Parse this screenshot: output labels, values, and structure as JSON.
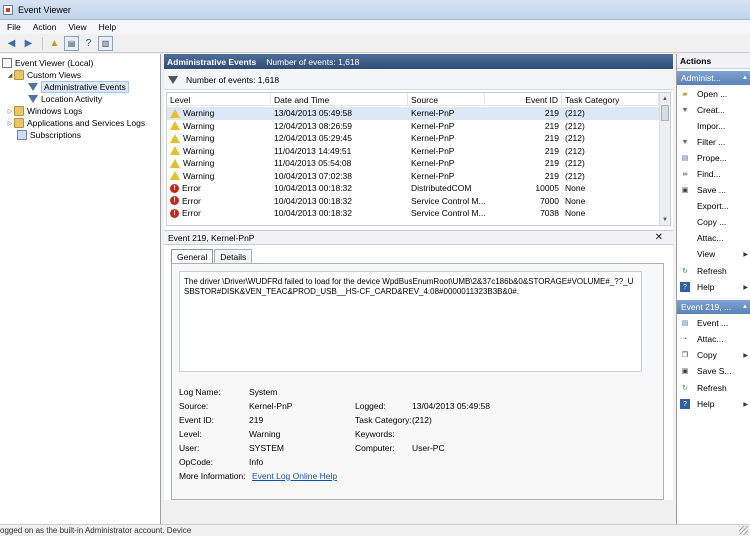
{
  "window": {
    "title": "Event Viewer"
  },
  "menu": [
    "File",
    "Action",
    "View",
    "Help"
  ],
  "tree": {
    "root": "Event Viewer (Local)",
    "custom_views": "Custom Views",
    "administrative_events": "Administrative Events",
    "location_activity": "Location Activity",
    "windows_logs": "Windows Logs",
    "apps_services_logs": "Applications and Services Logs",
    "subscriptions": "Subscriptions"
  },
  "center": {
    "header_title": "Administrative Events",
    "header_count": "Number of events: 1,618",
    "filter_count": "Number of events: 1,618"
  },
  "grid": {
    "columns": [
      "Level",
      "Date and Time",
      "Source",
      "Event ID",
      "Task Category"
    ],
    "rows": [
      {
        "level": "Warning",
        "date": "13/04/2013 05:49:58",
        "source": "Kernel-PnP",
        "id": "219",
        "task": "(212)"
      },
      {
        "level": "Warning",
        "date": "12/04/2013 08:26:59",
        "source": "Kernel-PnP",
        "id": "219",
        "task": "(212)"
      },
      {
        "level": "Warning",
        "date": "12/04/2013 05:29:45",
        "source": "Kernel-PnP",
        "id": "219",
        "task": "(212)"
      },
      {
        "level": "Warning",
        "date": "11/04/2013 14:49:51",
        "source": "Kernel-PnP",
        "id": "219",
        "task": "(212)"
      },
      {
        "level": "Warning",
        "date": "11/04/2013 05:54:08",
        "source": "Kernel-PnP",
        "id": "219",
        "task": "(212)"
      },
      {
        "level": "Warning",
        "date": "10/04/2013 07:02:38",
        "source": "Kernel-PnP",
        "id": "219",
        "task": "(212)"
      },
      {
        "level": "Error",
        "date": "10/04/2013 00:18:32",
        "source": "DistributedCOM",
        "id": "10005",
        "task": "None"
      },
      {
        "level": "Error",
        "date": "10/04/2013 00:18:32",
        "source": "Service Control M...",
        "id": "7000",
        "task": "None"
      },
      {
        "level": "Error",
        "date": "10/04/2013 00:18:32",
        "source": "Service Control M...",
        "id": "7038",
        "task": "None"
      }
    ]
  },
  "detail": {
    "header": "Event 219, Kernel-PnP",
    "tabs": [
      "General",
      "Details"
    ],
    "description": "The driver \\Driver\\WUDFRd failed to load for the device WpdBusEnumRoot\\UMB\\2&37c186b&0&STORAGE#VOLUME#_??_USBSTOR#DISK&VEN_TEAC&PROD_USB__HS-CF_CARD&REV_4.08#0000011323B3B&0#.",
    "log_name_label": "Log Name:",
    "log_name": "System",
    "source_label": "Source:",
    "source": "Kernel-PnP",
    "logged_label": "Logged:",
    "logged": "13/04/2013 05:49:58",
    "event_id_label": "Event ID:",
    "event_id": "219",
    "task_label": "Task Category:",
    "task": "(212)",
    "level_label": "Level:",
    "level": "Warning",
    "keywords_label": "Keywords:",
    "user_label": "User:",
    "user": "SYSTEM",
    "computer_label": "Computer:",
    "computer": "User-PC",
    "opcode_label": "OpCode:",
    "opcode": "Info",
    "more_info_label": "More Information:",
    "more_info_link": "Event Log Online Help"
  },
  "actions": {
    "title": "Actions",
    "section1": "Administ...",
    "items1": [
      "Open ...",
      "Creat...",
      "Impor...",
      "Filter ...",
      "Prope...",
      "Find...",
      "Save ...",
      "Export...",
      "Copy ...",
      "Attac...",
      "View",
      "Refresh",
      "Help"
    ],
    "section2": "Event 219, ...",
    "items2": [
      "Event ...",
      "Attac...",
      "Copy",
      "Save S...",
      "Refresh",
      "Help"
    ]
  },
  "status": {
    "text": "ogged on as the built-in Administrator account. Device"
  },
  "colors": {
    "header_blue": "#2f4c74",
    "action_section": "#5b82b7",
    "error_red": "#c8261d",
    "warning_yellow": "#e6c02b",
    "link": "#1a4fa8"
  }
}
